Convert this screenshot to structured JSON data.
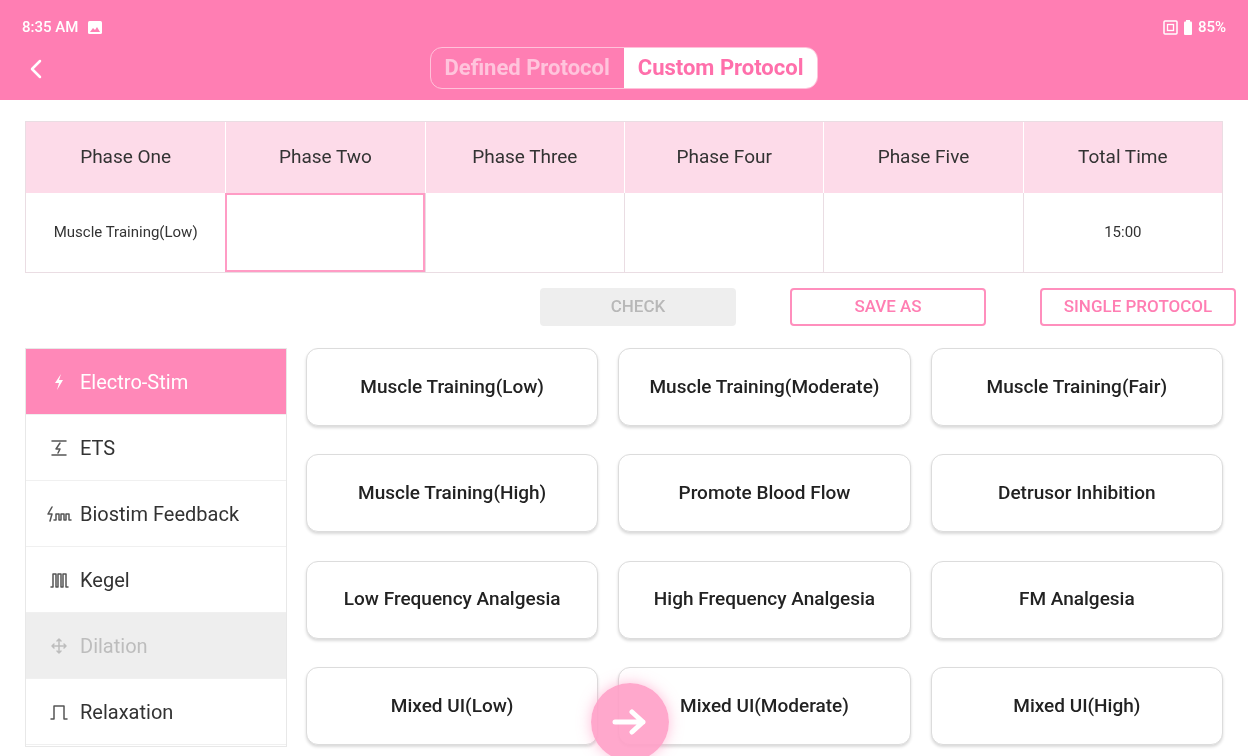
{
  "status_bar": {
    "time": "8:35 AM",
    "battery": "85%"
  },
  "tabs": [
    {
      "label": "Defined Protocol",
      "selected": false
    },
    {
      "label": "Custom Protocol",
      "selected": true
    }
  ],
  "table": {
    "columns": [
      "Phase One",
      "Phase Two",
      "Phase Three",
      "Phase Four",
      "Phase Five",
      "Total Time"
    ],
    "cells": [
      {
        "value": "Muscle Training(Low)",
        "selected": false
      },
      {
        "selected": true
      },
      {
        "selected": false
      },
      {
        "selected": false
      },
      {
        "selected": false
      },
      {
        "value": "15:00",
        "selected": false
      }
    ]
  },
  "actions": [
    {
      "label": "CHECK",
      "disabled": true
    },
    {
      "label": "SAVE AS",
      "disabled": false
    },
    {
      "label": "SINGLE PROTOCOL",
      "disabled": false
    }
  ],
  "sidebar": {
    "items": [
      {
        "kind": "bolt",
        "label": "Electro-Stim",
        "selected": true,
        "disabled": false
      },
      {
        "kind": "ets",
        "label": "ETS",
        "selected": false,
        "disabled": false
      },
      {
        "kind": "biostim",
        "label": "Biostim Feedback",
        "selected": false,
        "disabled": false
      },
      {
        "kind": "kegel",
        "label": "Kegel",
        "selected": false,
        "disabled": false
      },
      {
        "kind": "dilation",
        "label": "Dilation",
        "selected": false,
        "disabled": true
      },
      {
        "kind": "relax",
        "label": "Relaxation",
        "selected": false,
        "disabled": false
      }
    ]
  },
  "programs": [
    "Muscle Training(Low)",
    "Muscle Training(Moderate)",
    "Muscle Training(Fair)",
    "Muscle Training(High)",
    "Promote Blood Flow",
    "Detrusor Inhibition",
    "Low Frequency Analgesia",
    "High Frequency Analgesia",
    "FM Analgesia",
    "Mixed UI(Low)",
    "Mixed UI(Moderate)",
    "Mixed UI(High)"
  ]
}
